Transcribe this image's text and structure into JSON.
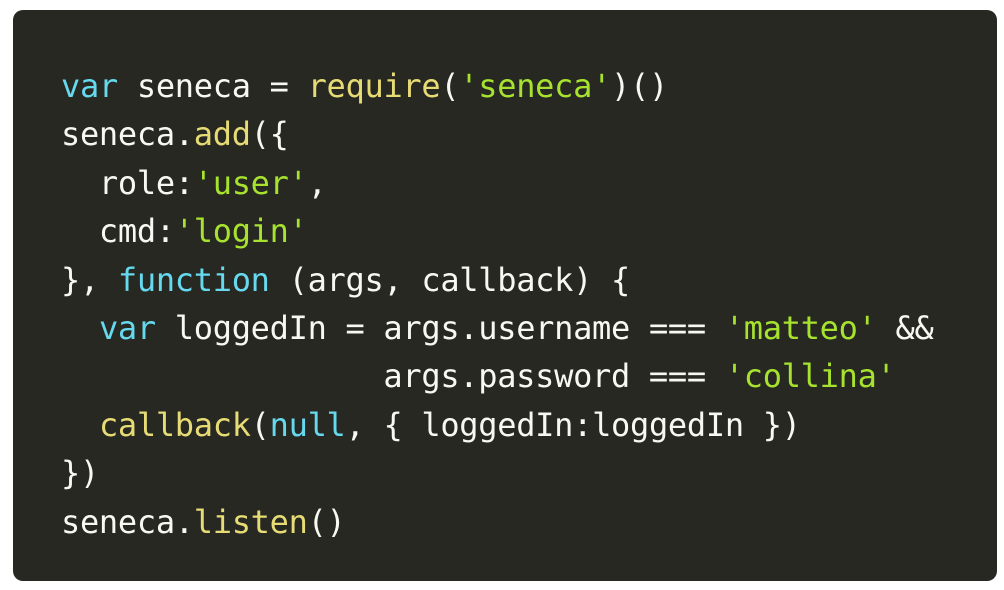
{
  "colors": {
    "background": "#272822",
    "plain": "#f8f8f2",
    "keyword": "#66d9ef",
    "function": "#e6db74",
    "string": "#a6e22e"
  },
  "code": {
    "lines": [
      [
        {
          "t": "kw",
          "v": "var"
        },
        {
          "t": "pl",
          "v": " seneca = "
        },
        {
          "t": "fn",
          "v": "require"
        },
        {
          "t": "pl",
          "v": "("
        },
        {
          "t": "str",
          "v": "'seneca'"
        },
        {
          "t": "pl",
          "v": ")()"
        }
      ],
      [
        {
          "t": "pl",
          "v": "seneca."
        },
        {
          "t": "fn",
          "v": "add"
        },
        {
          "t": "pl",
          "v": "({"
        }
      ],
      [
        {
          "t": "pl",
          "v": "  role:"
        },
        {
          "t": "str",
          "v": "'user'"
        },
        {
          "t": "pl",
          "v": ","
        }
      ],
      [
        {
          "t": "pl",
          "v": "  cmd:"
        },
        {
          "t": "str",
          "v": "'login'"
        }
      ],
      [
        {
          "t": "pl",
          "v": "}, "
        },
        {
          "t": "kw",
          "v": "function"
        },
        {
          "t": "pl",
          "v": " (args, callback) {"
        }
      ],
      [
        {
          "t": "pl",
          "v": "  "
        },
        {
          "t": "kw",
          "v": "var"
        },
        {
          "t": "pl",
          "v": " loggedIn = args.username === "
        },
        {
          "t": "str",
          "v": "'matteo'"
        },
        {
          "t": "pl",
          "v": " &&"
        }
      ],
      [
        {
          "t": "pl",
          "v": "                 args.password === "
        },
        {
          "t": "str",
          "v": "'collina'"
        }
      ],
      [
        {
          "t": "pl",
          "v": "  "
        },
        {
          "t": "fn",
          "v": "callback"
        },
        {
          "t": "pl",
          "v": "("
        },
        {
          "t": "kw",
          "v": "null"
        },
        {
          "t": "pl",
          "v": ", { loggedIn:loggedIn })"
        }
      ],
      [
        {
          "t": "pl",
          "v": "})"
        }
      ],
      [
        {
          "t": "pl",
          "v": "seneca."
        },
        {
          "t": "fn",
          "v": "listen"
        },
        {
          "t": "pl",
          "v": "()"
        }
      ]
    ]
  }
}
